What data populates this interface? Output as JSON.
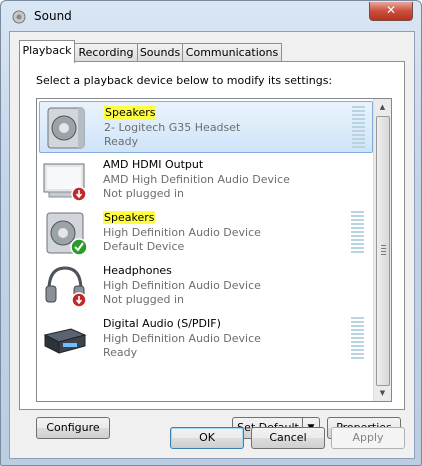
{
  "window": {
    "title": "Sound",
    "close_label": "✕"
  },
  "tabs": [
    {
      "label": "Playback"
    },
    {
      "label": "Recording"
    },
    {
      "label": "Sounds"
    },
    {
      "label": "Communications"
    }
  ],
  "playback": {
    "instruction": "Select a playback device below to modify its settings:",
    "devices": [
      {
        "name": "Speakers",
        "description": "2- Logitech G35 Headset",
        "status": "Ready",
        "icon": "speaker-icon"
      },
      {
        "name": "AMD HDMI Output",
        "description": "AMD High Definition Audio Device",
        "status": "Not plugged in",
        "icon": "monitor-icon"
      },
      {
        "name": "Speakers",
        "description": "High Definition Audio Device",
        "status": "Default Device",
        "icon": "speaker-icon"
      },
      {
        "name": "Headphones",
        "description": "High Definition Audio Device",
        "status": "Not plugged in",
        "icon": "headphones-icon"
      },
      {
        "name": "Digital Audio (S/PDIF)",
        "description": "High Definition Audio Device",
        "status": "Ready",
        "icon": "digital-audio-icon"
      }
    ]
  },
  "buttons": {
    "configure": "Configure",
    "set_default": "Set Default",
    "set_default_arrow": "▼",
    "properties": "Properties",
    "ok": "OK",
    "cancel": "Cancel",
    "apply": "Apply"
  },
  "scrollbar": {
    "up": "▲",
    "down": "▼"
  },
  "colors": {
    "highlight": "#ffff40",
    "selection": "#cfe4f9",
    "status_red": "#c0282a",
    "status_green": "#2a9a2a"
  }
}
